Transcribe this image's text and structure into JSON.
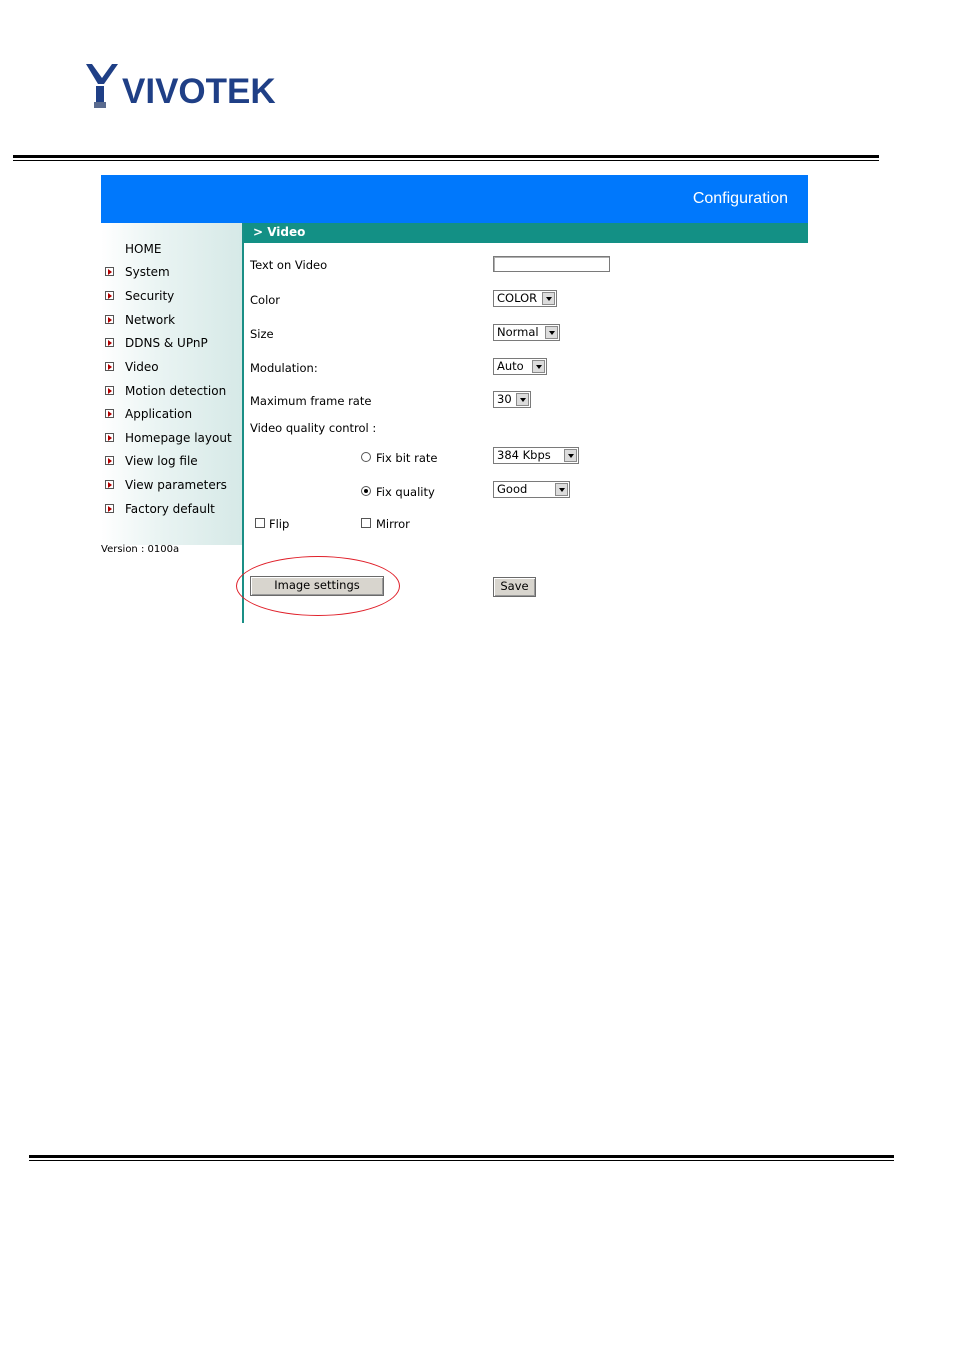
{
  "brand": {
    "logo_text": "VIVOTEK"
  },
  "header": {
    "title": "Configuration"
  },
  "section": {
    "title": "> Video"
  },
  "sidebar": {
    "home": "HOME",
    "items": [
      "System",
      "Security",
      "Network",
      "DDNS & UPnP",
      "Video",
      "Motion detection",
      "Application",
      "Homepage layout",
      "View log file",
      "View parameters",
      "Factory default"
    ],
    "version": "Version : 0100a"
  },
  "form": {
    "text_on_video": {
      "label": "Text on Video",
      "value": ""
    },
    "color": {
      "label": "Color",
      "value": "COLOR"
    },
    "size": {
      "label": "Size",
      "value": "Normal"
    },
    "modulation": {
      "label": "Modulation:",
      "value": "Auto"
    },
    "frame_rate": {
      "label": "Maximum frame rate",
      "value": "30"
    },
    "quality_control": {
      "label": "Video quality control :",
      "fix_bit_rate": {
        "label": "Fix bit rate",
        "value": "384 Kbps",
        "selected": false
      },
      "fix_quality": {
        "label": "Fix quality",
        "value": "Good",
        "selected": true
      }
    },
    "flip": {
      "label": "Flip",
      "checked": false
    },
    "mirror": {
      "label": "Mirror",
      "checked": false
    },
    "image_settings_button": "Image settings",
    "save_button": "Save"
  },
  "colors": {
    "banner": "#0078fc",
    "teal": "#139085",
    "annotation": "#e0202a"
  }
}
